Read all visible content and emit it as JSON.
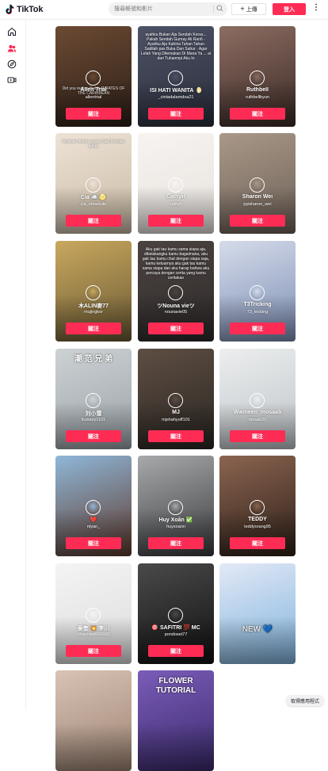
{
  "app": {
    "name": "TikTok"
  },
  "search": {
    "placeholder": "搜尋帳號和影片"
  },
  "header": {
    "upload_label": "上傳",
    "login_label": "登入",
    "more_label": "⋮"
  },
  "nav": [
    {
      "icon": "home-icon"
    },
    {
      "icon": "following-icon"
    },
    {
      "icon": "explore-icon"
    },
    {
      "icon": "live-icon"
    }
  ],
  "follow_label": "關注",
  "cards": [
    {
      "name": "Allen Trial",
      "handle": "allentrial",
      "overlay": "Did you realize that in PIRATES OF THE CARIBBEAN",
      "bg": [
        "#2d1f17",
        "#6b4a33"
      ]
    },
    {
      "name": "ISI HATI WANITA 🌔",
      "handle": "_cintadalamdoa21",
      "overlay": "ayahku Bukan Aja Sendah Keras... Pakah Sendah Gurnay Ali Ran6 · Ayahku Aja Kahiria Tahan Tahan Sadilah pas Buka Dan Sahur · Agar Lelah Yang Ditemakan Di Mana Ya ... ai dari Tuhanmpi Aku In",
      "bg": [
        "#2b2f3b",
        "#4d5266"
      ]
    },
    {
      "name": "Ruthbell",
      "handle": "ruthbellbyun",
      "overlay": "",
      "bg": [
        "#3b2a26",
        "#8c6d62"
      ]
    },
    {
      "name": "Cia ☁️ 🌝",
      "handle": "cia_rimastute",
      "overlay": "Nyobain Ikutan puasa Sapi di bulan sahur",
      "bg": [
        "#c9b9a4",
        "#ede3d6"
      ]
    },
    {
      "name": "CathyH",
      "handle": "cathyh",
      "overlay": "",
      "bg": [
        "#e6e1dc",
        "#f7f4f1"
      ]
    },
    {
      "name": "Sharon Wei",
      "handle": "pyisharon_wei",
      "overlay": "",
      "bg": [
        "#6d6057",
        "#a99888"
      ]
    },
    {
      "name": "木ALIN麥77",
      "handle": "mujingkor",
      "overlay": "",
      "bg": [
        "#6a5a35",
        "#c9a85e"
      ]
    },
    {
      "name": "ツNouna vieツ",
      "handle": "nounavie05",
      "overlay": "Aku gak tau kamu sama siapa aja, dibelakangku kamu bagaimana, aku gak tau kamu chat dengan siapa saja, kamu keluarnya aku gak tau kamu sama siapa dan aku harap bahwa aku percaya dengan cerita yang kamu ceritakan",
      "bg": [
        "#2e2a2a",
        "#4b4341"
      ]
    },
    {
      "name": "T3Tricking",
      "handle": "73_tricking",
      "overlay": "",
      "bg": [
        "#7d8fb4",
        "#d5dbea"
      ]
    },
    {
      "name": "刘小雪",
      "handle": "liuxiaoy1101",
      "overlay": "潮 范 兄 弟",
      "bg": [
        "#9aa2a8",
        "#cdd2d4"
      ]
    },
    {
      "name": "MJ",
      "handle": "mjshahyuff101",
      "overlay": "",
      "bg": [
        "#2a2622",
        "#5e4e43"
      ]
    },
    {
      "name": "Wwmeen_mosaab",
      "handle": "mosab20",
      "overlay": "",
      "bg": [
        "#bfc4c7",
        "#eceeef"
      ]
    },
    {
      "name": "❤️",
      "handle": "ntyan_",
      "overlay": "",
      "bg": [
        "#5e3a2c",
        "#8fb7d9"
      ]
    },
    {
      "name": "Huy Xoắn ✅",
      "handle": "huyxoann",
      "overlay": "",
      "bg": [
        "#3a3b3d",
        "#a7a9ab"
      ]
    },
    {
      "name": "TEDDY",
      "handle": "teddyorang95",
      "overlay": "",
      "bg": [
        "#2e2019",
        "#8b6450"
      ]
    },
    {
      "name": "泰奎 💥 李川",
      "handle": "chuenlee666666",
      "overlay": "",
      "bg": [
        "#dcdcdc",
        "#f4f4f4"
      ]
    },
    {
      "name": "🎯 SAFITRI 💯 MC",
      "handle": "pondoset77",
      "overlay": "",
      "bg": [
        "#111111",
        "#4a4a4a"
      ]
    },
    {
      "name": "",
      "handle": "",
      "overlay": "NEW 💙",
      "bg": [
        "#7fb3dd",
        "#e3e9f6"
      ]
    },
    {
      "name": "",
      "handle": "",
      "overlay": "",
      "bg": [
        "#9e8474",
        "#d8c3b4"
      ]
    },
    {
      "name": "",
      "handle": "",
      "overlay": "FLOWER TUTORIAL",
      "bg": [
        "#3c2b6e",
        "#7a5cb8"
      ]
    }
  ],
  "get_app_label": "取得應用程式",
  "colors": {
    "accent": "#fe2c55"
  }
}
